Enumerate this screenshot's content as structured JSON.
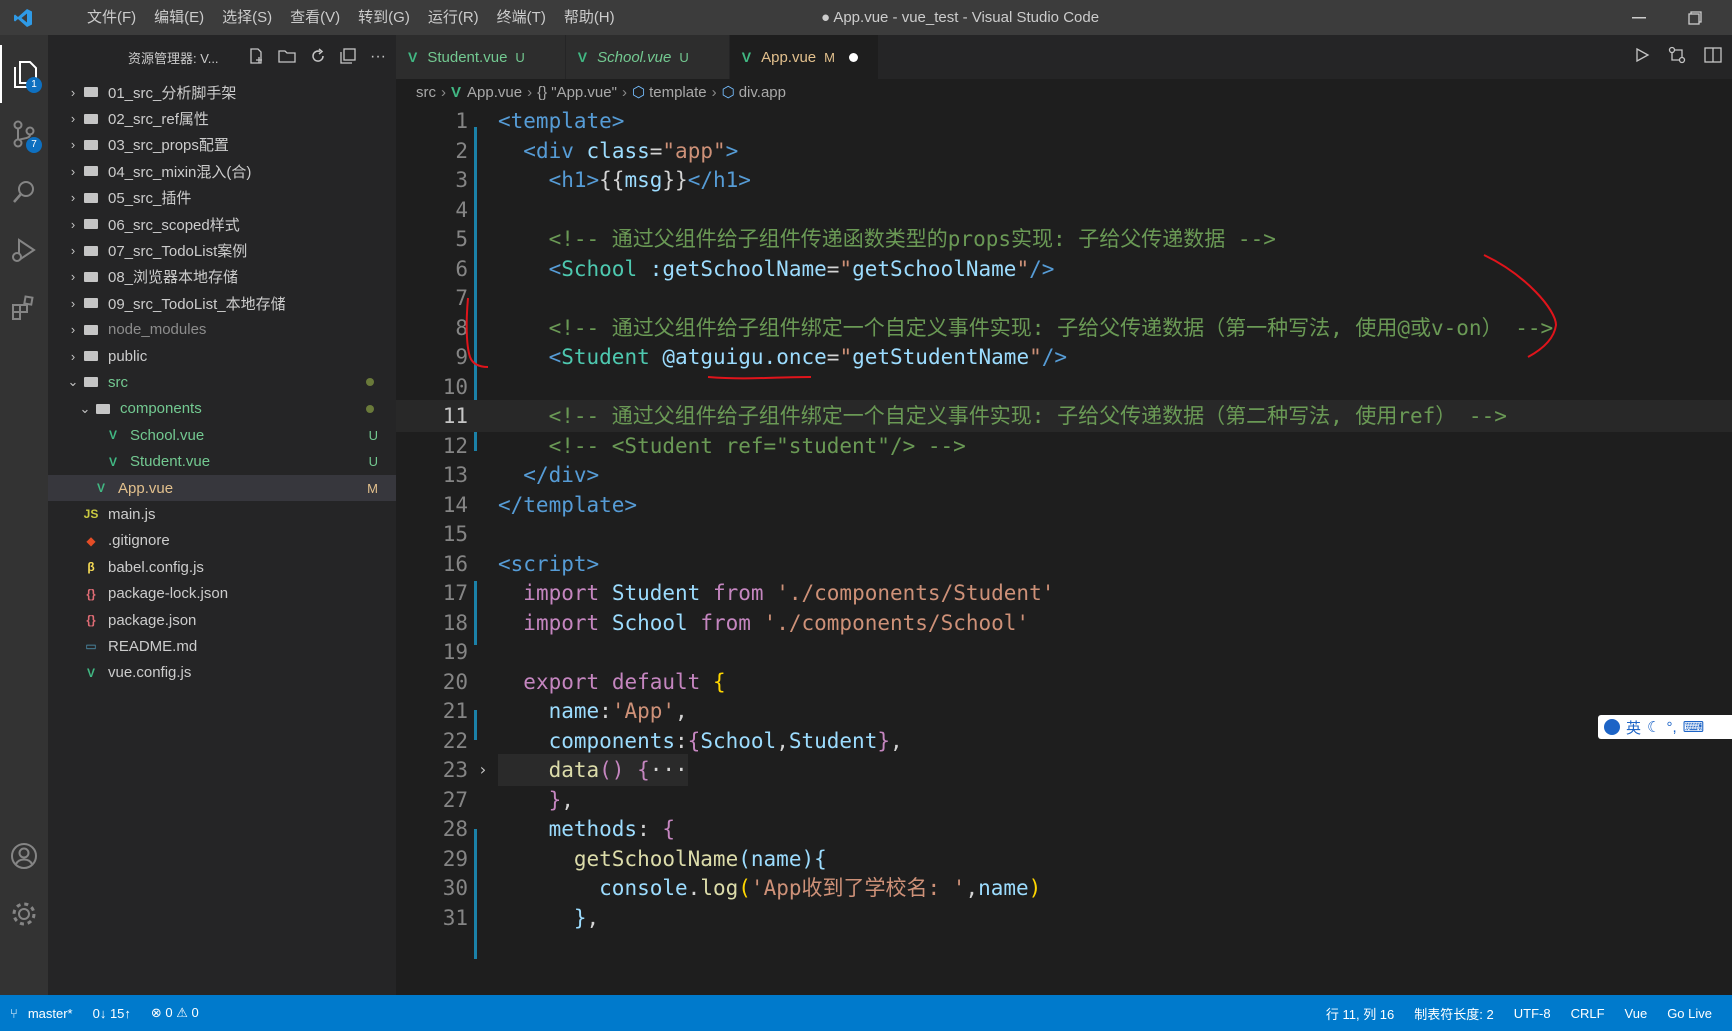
{
  "titlebar": {
    "menu": [
      "文件(F)",
      "编辑(E)",
      "选择(S)",
      "查看(V)",
      "转到(G)",
      "运行(R)",
      "终端(T)",
      "帮助(H)"
    ],
    "title": "● App.vue - vue_test - Visual Studio Code"
  },
  "activity": {
    "explorer_badge": "1",
    "scm_badge": "7"
  },
  "sidebar": {
    "header": "资源管理器: V...",
    "items": [
      {
        "label": "01_src_分析脚手架",
        "type": "folder"
      },
      {
        "label": "02_src_ref属性",
        "type": "folder"
      },
      {
        "label": "03_src_props配置",
        "type": "folder"
      },
      {
        "label": "04_src_mixin混入(合)",
        "type": "folder"
      },
      {
        "label": "05_src_插件",
        "type": "folder"
      },
      {
        "label": "06_src_scoped样式",
        "type": "folder"
      },
      {
        "label": "07_src_TodoList案例",
        "type": "folder"
      },
      {
        "label": "08_浏览器本地存储",
        "type": "folder"
      },
      {
        "label": "09_src_TodoList_本地存储",
        "type": "folder"
      },
      {
        "label": "node_modules",
        "type": "folder-dim"
      },
      {
        "label": "public",
        "type": "folder"
      },
      {
        "label": "src",
        "type": "folder-open"
      },
      {
        "label": "components",
        "type": "folder-open"
      },
      {
        "label": "School.vue",
        "type": "vue",
        "status": "U"
      },
      {
        "label": "Student.vue",
        "type": "vue",
        "status": "U"
      },
      {
        "label": "App.vue",
        "type": "vue",
        "status": "M"
      },
      {
        "label": "main.js",
        "type": "js"
      },
      {
        "label": ".gitignore",
        "type": "git"
      },
      {
        "label": "babel.config.js",
        "type": "babel"
      },
      {
        "label": "package-lock.json",
        "type": "json"
      },
      {
        "label": "package.json",
        "type": "json"
      },
      {
        "label": "README.md",
        "type": "md"
      },
      {
        "label": "vue.config.js",
        "type": "vue"
      }
    ]
  },
  "tabs": [
    {
      "label": "Student.vue",
      "status": "U"
    },
    {
      "label": "School.vue",
      "status": "U"
    },
    {
      "label": "App.vue",
      "status": "M"
    }
  ],
  "breadcrumb": [
    "src",
    "App.vue",
    "{} \"App.vue\"",
    "template",
    "div.app"
  ],
  "editor": {
    "line_numbers": [
      "1",
      "2",
      "3",
      "4",
      "5",
      "6",
      "7",
      "8",
      "9",
      "10",
      "11",
      "12",
      "13",
      "14",
      "15",
      "16",
      "17",
      "18",
      "19",
      "20",
      "21",
      "22",
      "23",
      "27",
      "28",
      "29",
      "30",
      "31"
    ],
    "current_line": "11",
    "comment5": "<!-- 通过父组件给子组件传递函数类型的props实现: 子给父传递数据 -->",
    "comment8": "<!-- 通过父组件给子组件绑定一个自定义事件实现: 子给父传递数据（第一种写法, 使用@或v-on） -->",
    "comment11": "<!-- 通过父组件给子组件绑定一个自定义事件实现: 子给父传递数据（第二种写法, 使用ref） -->",
    "comment12": "<!-- <Student ref=\"student\"/> -->",
    "import1_path": "'./components/Student'",
    "import2_path": "'./components/School'",
    "app_name": "'App'",
    "log_str": "'App收到了学校名: '"
  },
  "ime": {
    "label": "英"
  },
  "statusbar": {
    "branch": "master*",
    "sync": "0↓ 15↑",
    "problems": "⊗ 0 ⚠ 0",
    "position": "行 11, 列 16",
    "indent": "制表符长度: 2",
    "encoding": "UTF-8",
    "eol": "CRLF",
    "language": "Vue",
    "golive": "Go Live"
  }
}
